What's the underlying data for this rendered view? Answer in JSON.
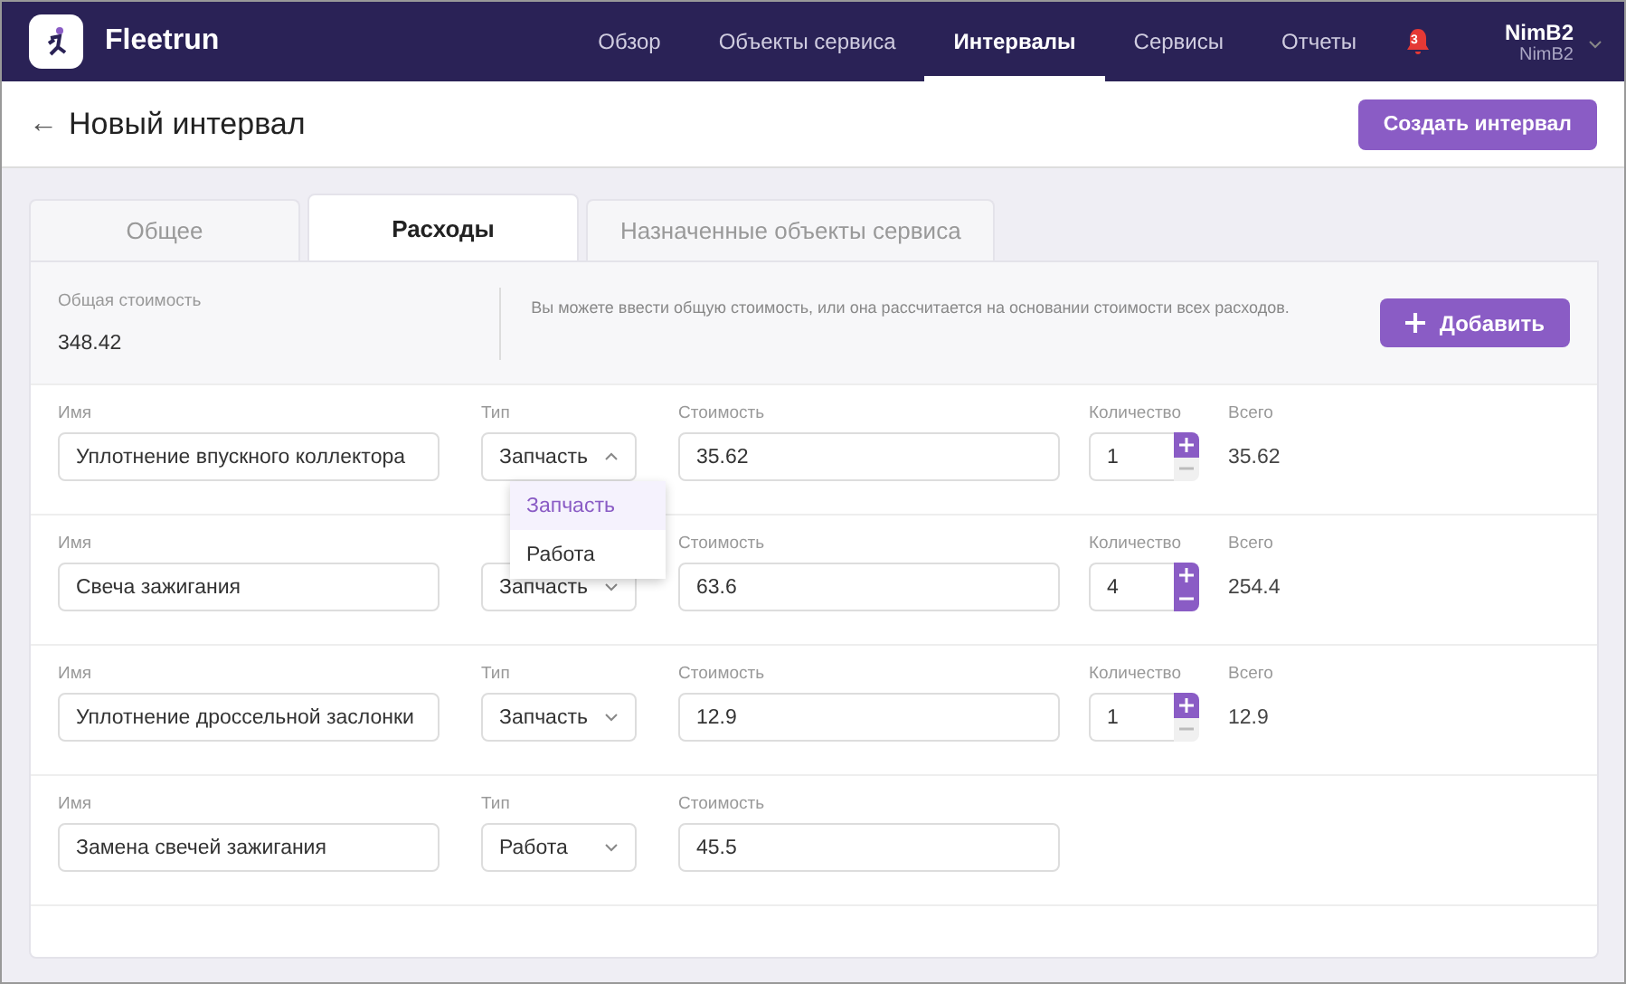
{
  "app": {
    "name": "Fleetrun"
  },
  "nav": [
    {
      "label": "Обзор",
      "selected": false
    },
    {
      "label": "Объекты сервиса",
      "selected": false
    },
    {
      "label": "Интервалы",
      "selected": true
    },
    {
      "label": "Сервисы",
      "selected": false
    },
    {
      "label": "Отчеты",
      "selected": false
    }
  ],
  "notifications": {
    "count": "3"
  },
  "user": {
    "name": "NimB2",
    "account": "NimB2"
  },
  "page": {
    "back": "←",
    "title": "Новый интервал",
    "create_button": "Создать интервал"
  },
  "tabs": [
    {
      "label": "Общее",
      "selected": false
    },
    {
      "label": "Расходы",
      "selected": true
    },
    {
      "label": "Назначенные объекты сервиса",
      "selected": false
    }
  ],
  "summary": {
    "label": "Общая стоимость",
    "value": "348.42",
    "hint": "Вы можете ввести общую стоимость, или она рассчитается на основании стоимости всех расходов.",
    "add_button": "Добавить"
  },
  "expenses": [
    {
      "name_label": "Имя",
      "name": "Уплотнение впускного коллектора",
      "type_label": "Тип",
      "type": "Запчасть",
      "open": true,
      "options": [
        {
          "label": "Запчасть",
          "selected": true
        },
        {
          "label": "Работа",
          "selected": false
        }
      ],
      "cost_label": "Стоимость",
      "cost": "35.62",
      "quantity_label": "Количество",
      "quantity": "1",
      "minus_disabled": true,
      "total_label": "Всего",
      "total": "35.62"
    },
    {
      "name_label": "Имя",
      "name": "Свеча зажигания",
      "type": "Запчасть",
      "open": false,
      "cost_label": "Стоимость",
      "cost": "63.6",
      "quantity_label": "Количество",
      "quantity": "4",
      "minus_disabled": false,
      "total_label": "Всего",
      "total": "254.4"
    },
    {
      "name_label": "Имя",
      "name": "Уплотнение дроссельной заслонки",
      "type_label": "Тип",
      "type": "Запчасть",
      "open": false,
      "cost_label": "Стоимость",
      "cost": "12.9",
      "quantity_label": "Количество",
      "quantity": "1",
      "minus_disabled": true,
      "total_label": "Всего",
      "total": "12.9"
    },
    {
      "name_label": "Имя",
      "name": "Замена свечей зажигания",
      "type_label": "Тип",
      "type": "Работа",
      "open": false,
      "cost_label": "Стоимость",
      "cost": "45.5"
    }
  ]
}
